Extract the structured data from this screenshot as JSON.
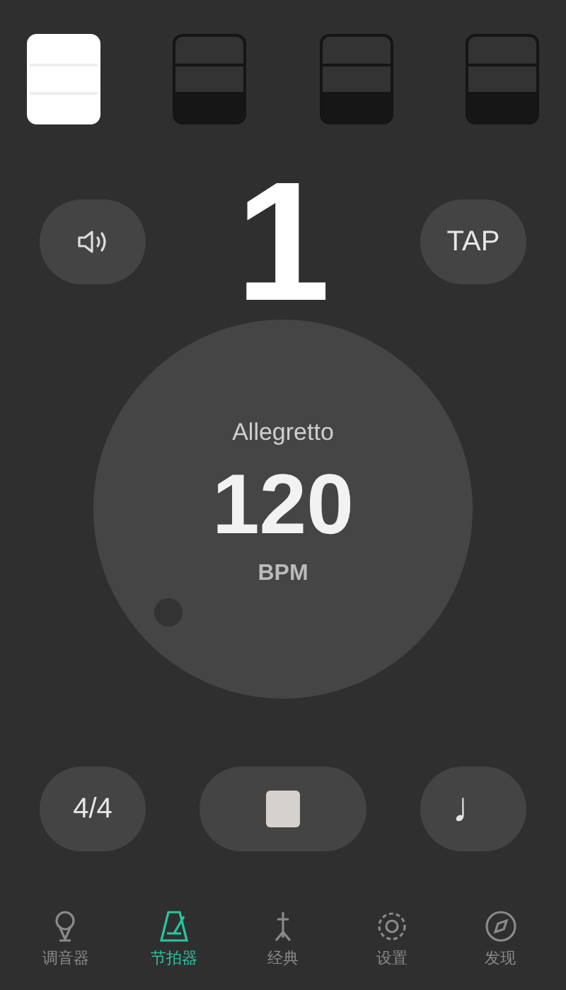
{
  "beats": [
    {
      "selected": true
    },
    {
      "selected": false
    },
    {
      "selected": false
    },
    {
      "selected": false
    }
  ],
  "current_beat": "1",
  "tap_button": "TAP",
  "dial": {
    "tempo_name": "Allegretto",
    "bpm": "120",
    "unit": "BPM"
  },
  "time_signature": "4/4",
  "note_value": "♩",
  "tabs": [
    {
      "label": "调音器",
      "selected": false
    },
    {
      "label": "节拍器",
      "selected": true
    },
    {
      "label": "经典",
      "selected": false
    },
    {
      "label": "设置",
      "selected": false
    },
    {
      "label": "发现",
      "selected": false
    }
  ]
}
